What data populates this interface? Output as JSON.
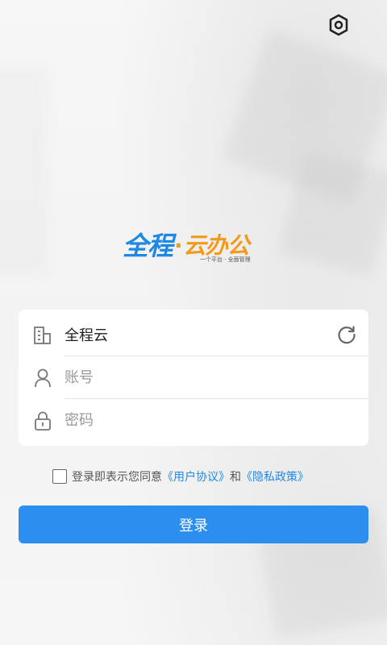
{
  "header": {
    "settings_icon": "settings-hexagon-icon"
  },
  "logo": {
    "brand_blue": "全程",
    "dot": "·",
    "brand_orange": "云办公",
    "slogan": "一个平台 · 全面管理",
    "colors": {
      "blue": "#1e88e5",
      "orange": "#f29a1a"
    }
  },
  "form": {
    "company": {
      "value": "全程云",
      "icon": "building-icon",
      "action_icon": "refresh-icon"
    },
    "account": {
      "placeholder": "账号",
      "icon": "user-icon"
    },
    "password": {
      "placeholder": "密码",
      "icon": "lock-icon"
    }
  },
  "agreement": {
    "prefix": "登录即表示您同意",
    "user_agreement": "《用户协议》",
    "and": "和",
    "privacy_policy": "《隐私政策》"
  },
  "login_button": {
    "label": "登录",
    "color": "#2c8ff0"
  }
}
